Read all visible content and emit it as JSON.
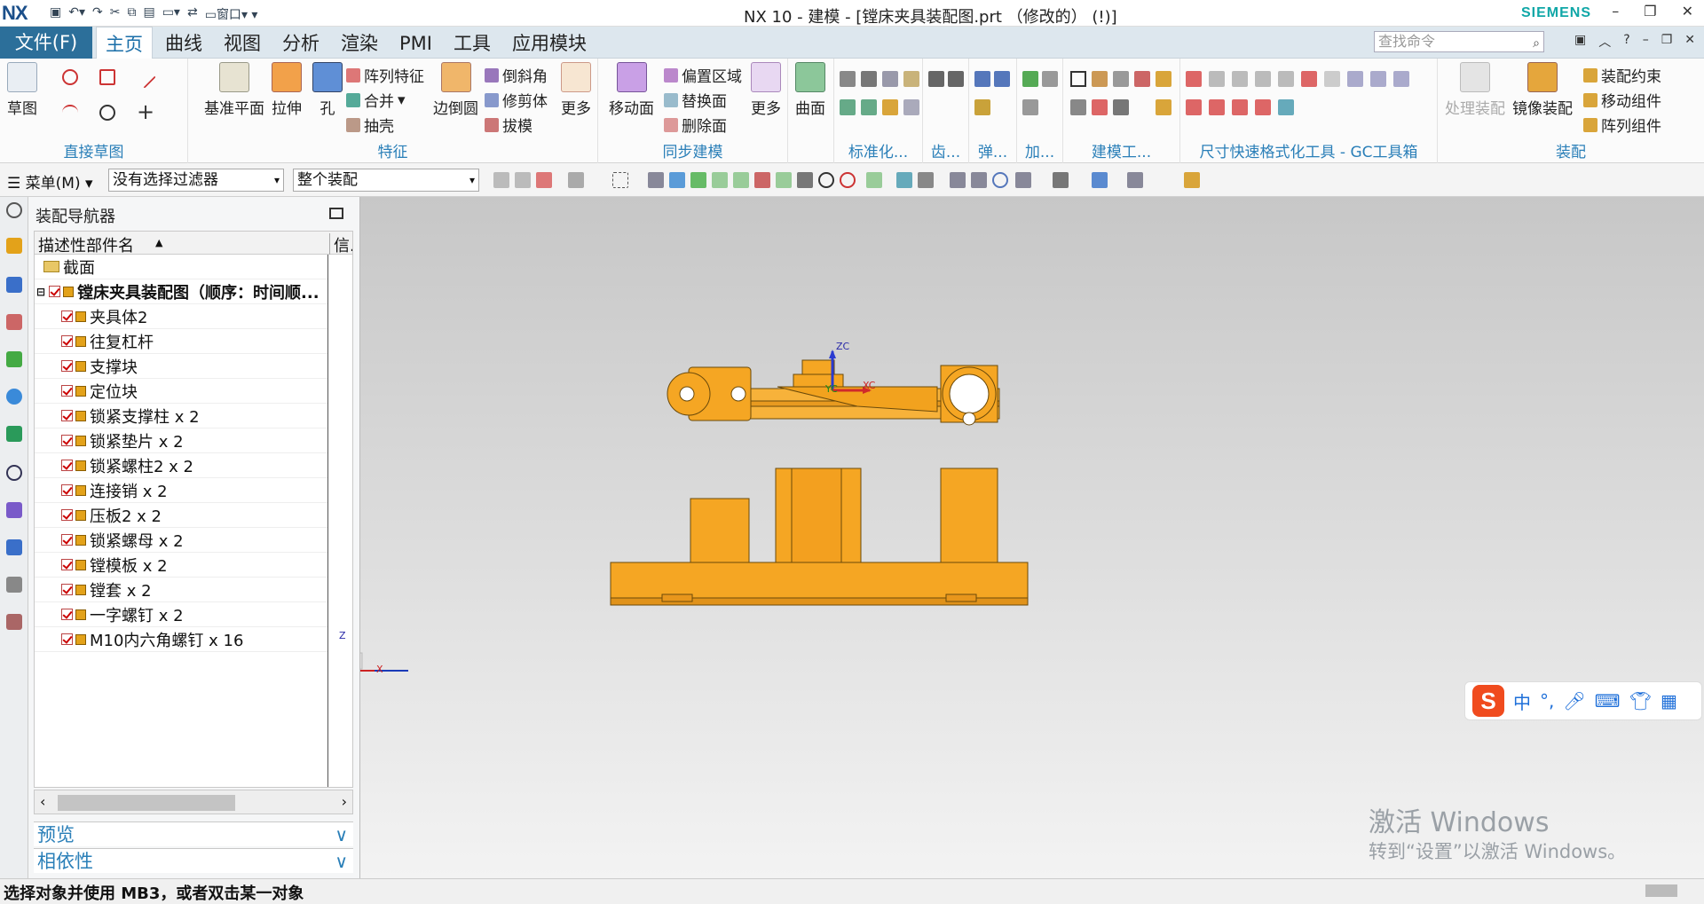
{
  "app": {
    "logo": "NX",
    "title": "NX 10 - 建模 - [镗床夹具装配图.prt （修改的）   (!)]",
    "brand": "SIEMENS",
    "window_label": "窗口"
  },
  "menubar": {
    "file": "文件(F)",
    "tabs": [
      "主页",
      "曲线",
      "视图",
      "分析",
      "渲染",
      "PMI",
      "工具",
      "应用模块"
    ],
    "active_tab": "主页",
    "search_placeholder": "查找命令"
  },
  "ribbon": {
    "direct_sketch": {
      "label": "直接草图",
      "sketch": "草图"
    },
    "feature": {
      "label": "特征",
      "datum_plane": "基准平面",
      "extrude": "拉伸",
      "hole": "孔",
      "pattern_feature": "阵列特征",
      "unite": "合并",
      "shell": "抽壳",
      "edge_blend": "边倒圆",
      "chamfer": "倒斜角",
      "trim_body": "修剪体",
      "draft": "拔模",
      "more": "更多"
    },
    "sync": {
      "label": "同步建模",
      "move_face": "移动面",
      "offset_region": "偏置区域",
      "replace_face": "替换面",
      "delete_face": "删除面",
      "more": "更多"
    },
    "surface": {
      "label": "曲面"
    },
    "standard": {
      "label": "标准化..."
    },
    "gear": {
      "label": "齿..."
    },
    "spring": {
      "label": "弹..."
    },
    "add": {
      "label": "加..."
    },
    "modeling_tools": {
      "label": "建模工..."
    },
    "gc_toolbox": {
      "label": "尺寸快速格式化工具 - GC工具箱"
    },
    "assembly": {
      "label": "装配",
      "process_assembly": "处理装配",
      "mirror_assembly": "镜像装配",
      "assembly_constraints": "装配约束",
      "move_component": "移动组件",
      "pattern_component": "阵列组件"
    }
  },
  "toolbar2": {
    "menu": "菜单(M)",
    "filter": "没有选择过滤器",
    "scope": "整个装配"
  },
  "navigator": {
    "title": "装配导航器",
    "col_name": "描述性部件名",
    "col_info": "信..",
    "section": "截面",
    "root": "镗床夹具装配图（顺序：时间顺...",
    "parts": [
      "夹具体2",
      "往复杠杆",
      "支撑块",
      "定位块",
      "锁紧支撑柱 x 2",
      "锁紧垫片 x 2",
      "锁紧螺柱2 x 2",
      "连接销 x 2",
      "压板2 x 2",
      "锁紧螺母 x 2",
      "镗模板 x 2",
      "镗套 x 2",
      "一字螺钉 x 2",
      "M10内六角螺钉 x 16"
    ],
    "preview": "预览",
    "dependencies": "相依性"
  },
  "viewport": {
    "zc": "ZC",
    "xc": "XC",
    "yc": "YC",
    "triad_z": "Z",
    "triad_x": "X",
    "model_color": "#f5a623"
  },
  "ime": {
    "chinese": "中",
    "punct": "°,"
  },
  "watermark": {
    "line1": "激活 Windows",
    "line2": "转到“设置”以激活 Windows。"
  },
  "status": {
    "message": "选择对象并使用 MB3，或者双击某一对象"
  }
}
